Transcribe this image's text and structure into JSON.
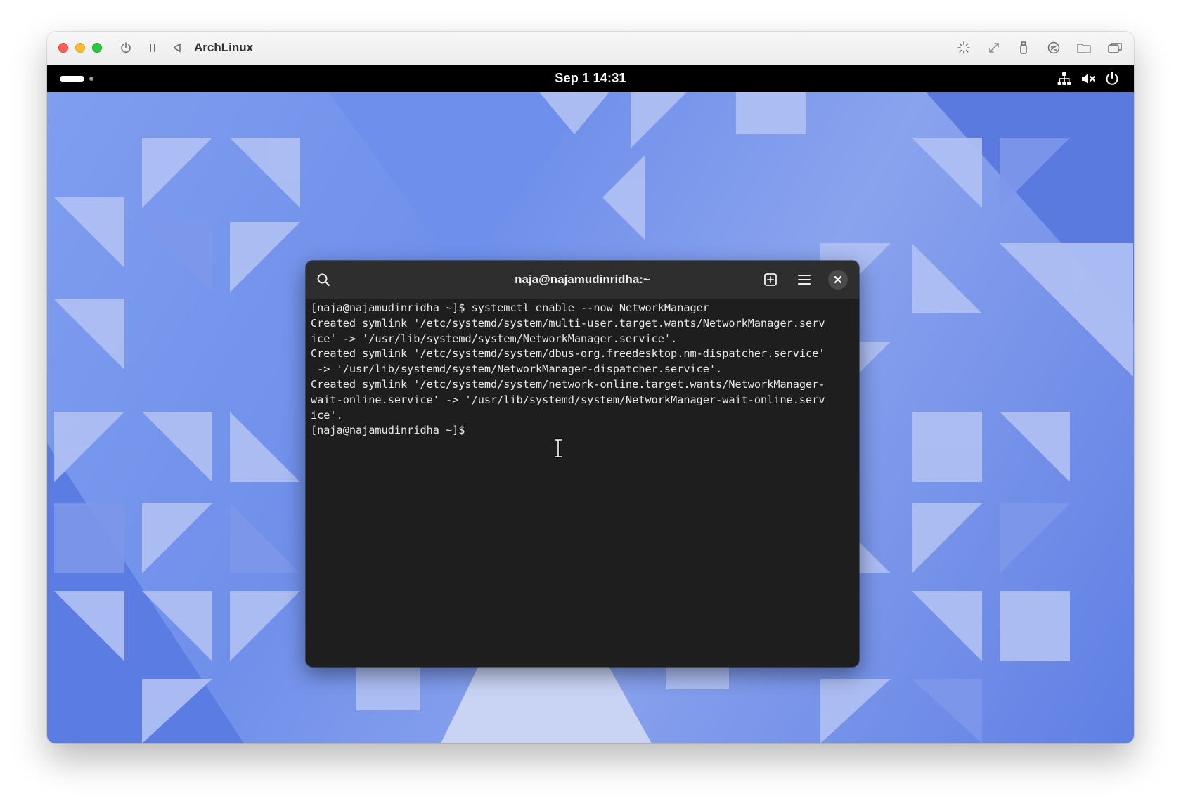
{
  "vm_window": {
    "title": "ArchLinux",
    "traffic_lights": [
      "close",
      "minimize",
      "zoom"
    ],
    "left_toolbar_icons": [
      "power-icon",
      "pause-icon",
      "back-icon"
    ],
    "right_toolbar_icons": [
      "brightness-icon",
      "resize-icon",
      "usb-icon",
      "network-share-icon",
      "shared-folder-icon",
      "windows-icon"
    ]
  },
  "top_bar": {
    "clock": "Sep 1  14:31",
    "tray_icons": [
      "network-wired-icon",
      "speaker-muted-icon",
      "power-icon"
    ]
  },
  "terminal": {
    "title": "naja@najamudinridha:~",
    "buttons": [
      "search",
      "new-tab",
      "menu",
      "close"
    ],
    "lines": [
      "[naja@najamudinridha ~]$ systemctl enable --now NetworkManager",
      "Created symlink '/etc/systemd/system/multi-user.target.wants/NetworkManager.serv",
      "ice' -> '/usr/lib/systemd/system/NetworkManager.service'.",
      "Created symlink '/etc/systemd/system/dbus-org.freedesktop.nm-dispatcher.service'",
      " -> '/usr/lib/systemd/system/NetworkManager-dispatcher.service'.",
      "Created symlink '/etc/systemd/system/network-online.target.wants/NetworkManager-",
      "wait-online.service' -> '/usr/lib/systemd/system/NetworkManager-wait-online.serv",
      "ice'.",
      "[naja@najamudinridha ~]$ "
    ]
  },
  "colors": {
    "topbar_bg": "#000000",
    "terminal_bg": "#1e1e1e",
    "terminal_header_bg": "#2e2e2e",
    "wallpaper_base": "#6f8fea"
  }
}
